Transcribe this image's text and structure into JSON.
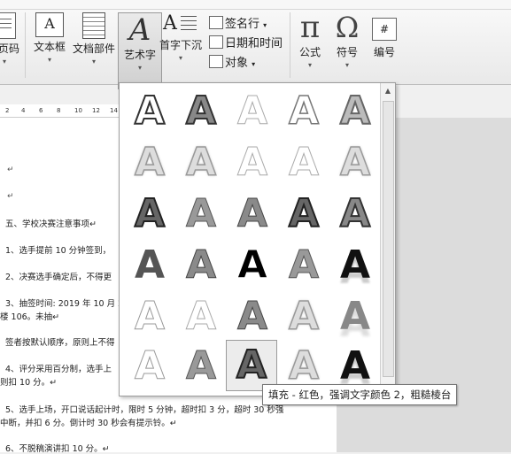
{
  "ribbon": {
    "partial_label": "页码",
    "textbox_label": "文本框",
    "parts_label": "文档部件",
    "wordart_label": "艺术字",
    "dropcap_label": "首字下沉",
    "signature_label": "签名行",
    "datetime_label": "日期和时间",
    "object_label": "对象",
    "equation_label": "公式",
    "symbol_label": "符号",
    "number_label": "编号",
    "dropdown_glyph": "▾",
    "num_icon_glyph": "#"
  },
  "ruler": {
    "ticks": [
      "2",
      "4",
      "6",
      "8",
      "10",
      "12",
      "14"
    ]
  },
  "document": {
    "para_mark": "↵",
    "lines": [
      "五、学校决赛注意事项↵",
      "1、选手提前 10 分钟签到，",
      "2、决赛选手确定后，不得更",
      "3、抽签时间: 2019 年 10 月 2",
      "楼 106。未抽↵",
      "签者按默认顺序，原则上不得",
      "4、评分采用百分制，选手上",
      "则扣 10 分。↵",
      "5、选手上场，开口说话起计时，限时 5 分钟，超时扣 3 分，超时 30 秒强",
      "中断，并扣 6 分。倒计时 30 秒会有提示铃。↵",
      "6、不脱稿演讲扣 10 分。↵"
    ]
  },
  "gallery": {
    "letter": "A",
    "scroll_up": "▲",
    "scroll_down": "▼",
    "tooltip": "填充 - 红色，强调文字颜色 2，粗糙棱台"
  }
}
